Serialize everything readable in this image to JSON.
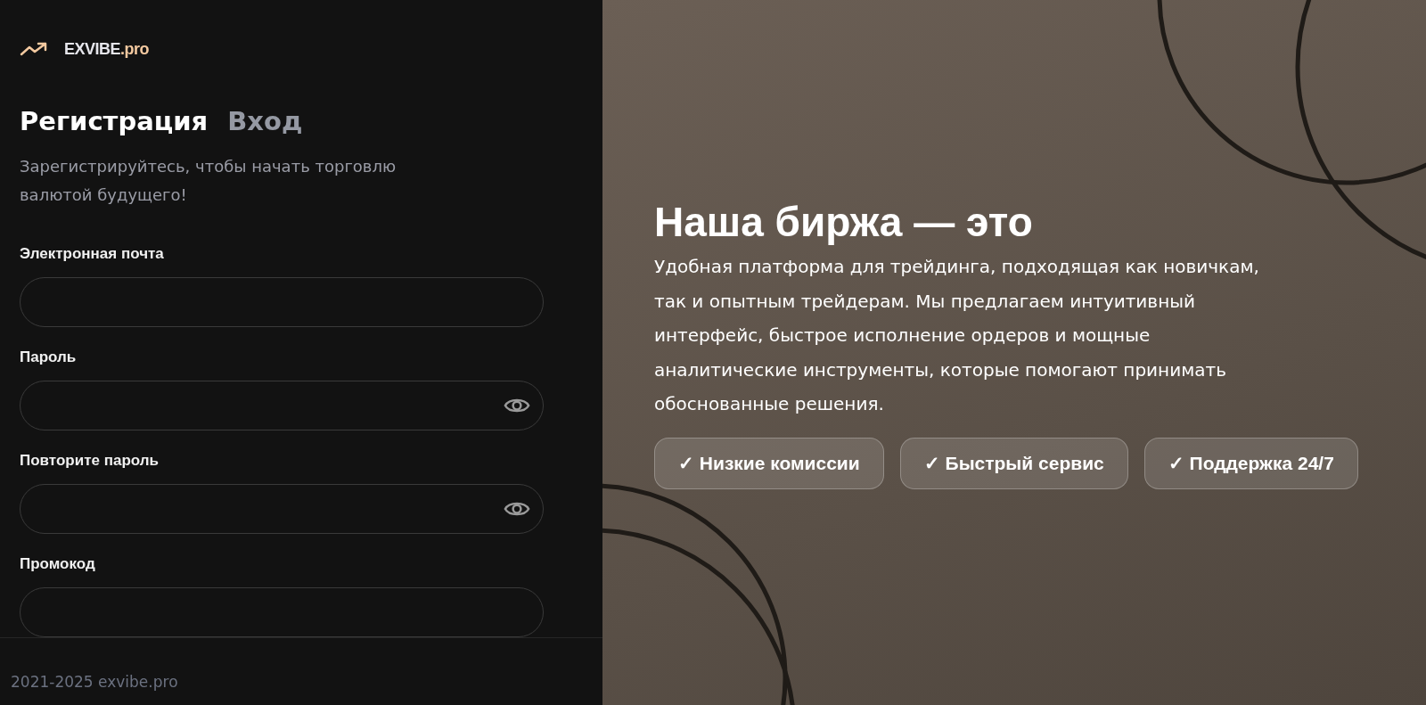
{
  "logo": {
    "name": "EXVIBE",
    "suffix": ".pro"
  },
  "tabs": [
    {
      "label": "Регистрация",
      "selected": true
    },
    {
      "label": "Вход",
      "selected": false
    }
  ],
  "subtitle": "Зарегистрируйтесь, чтобы начать торговлю валютой будущего!",
  "fields": [
    {
      "label": "Электронная почта",
      "kind": "text"
    },
    {
      "label": "Пароль",
      "kind": "password"
    },
    {
      "label": "Повторите пароль",
      "kind": "password"
    },
    {
      "label": "Промокод",
      "kind": "text"
    }
  ],
  "footer": "2021-2025 exvibe.pro",
  "hero": {
    "title": "Наша биржа — это",
    "text": "Удобная платформа для трейдинга, подходящая как новичкам, так и опытным трейдерам. Мы предлагаем интуитивный интерфейс, быстрое исполнение ордеров и мощные аналитические инструменты, которые помогают принимать обоснованные решения.",
    "features": [
      "✓ Низкие комиссии",
      "✓ Быстрый сервис",
      "✓ Поддержка 24/7"
    ]
  }
}
